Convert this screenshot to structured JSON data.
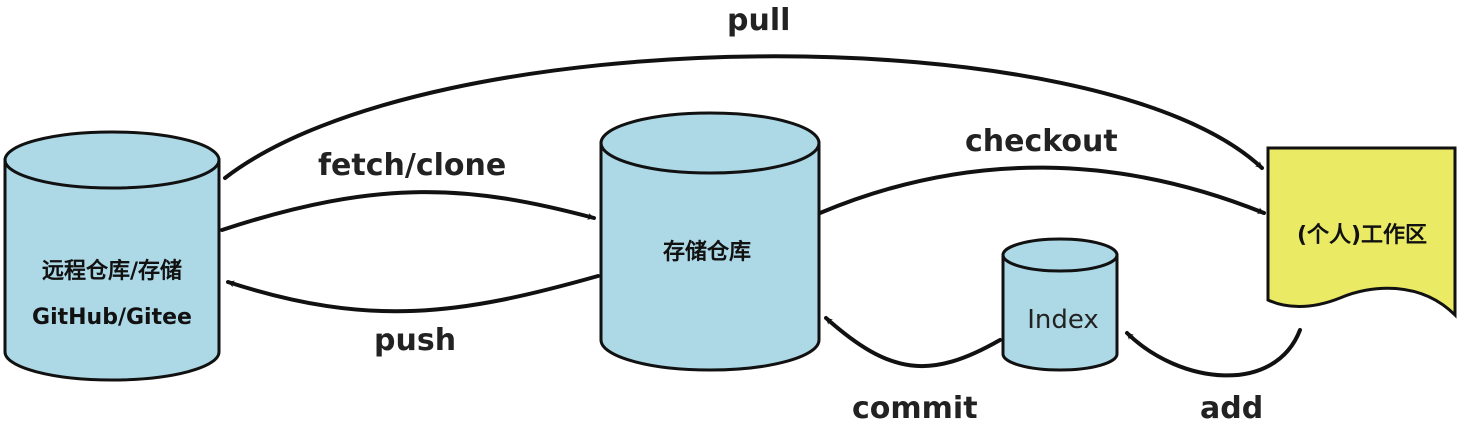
{
  "nodes": {
    "remote": {
      "line1": "远程仓库/存储",
      "line2": "GitHub/Gitee"
    },
    "repository": {
      "label": "存储仓库"
    },
    "index": {
      "label": "Index"
    },
    "workspace": {
      "label": "(个人)工作区"
    }
  },
  "edges": {
    "pull": "pull",
    "fetch_clone": "fetch/clone",
    "push": "push",
    "checkout": "checkout",
    "commit": "commit",
    "add": "add"
  },
  "colors": {
    "cylinder_fill": "#add8e6",
    "workspace_fill": "#eaea64",
    "stroke": "#111111"
  }
}
